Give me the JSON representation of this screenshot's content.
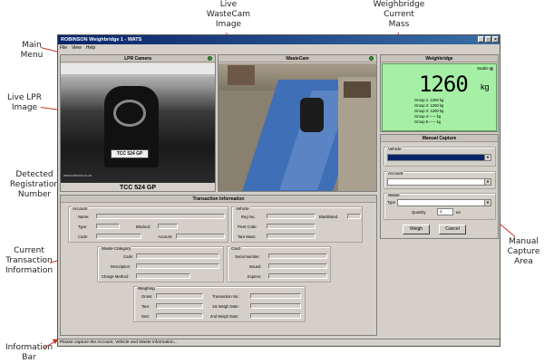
{
  "callouts": {
    "main_menu": "Main\nMenu",
    "live_wastecam": "Live\nWasteCam\nImage",
    "current_mass": "Weighbridge\nCurrent\nMass",
    "live_lpr": "Live LPR\nImage",
    "detected_reg": "Detected\nRegistration\nNumber",
    "current_tx": "Current\nTransaction\nInformation",
    "manual_capture": "Manual\nCapture\nArea",
    "info_bar": "Information\nBar"
  },
  "window": {
    "title": "ROBINSON Weighbridge 1 - WATS",
    "controls": [
      "_",
      "□",
      "×"
    ]
  },
  "menu": [
    "File",
    "View",
    "Help"
  ],
  "lpr": {
    "header": "LPR Camera",
    "plate": "TCC 524 GP",
    "overlay_text": "www.robinson.co.za"
  },
  "wastecam": {
    "header": "WasteCam"
  },
  "weighbridge": {
    "header": "Weighbridge",
    "stable": "Stable",
    "mass": "1260",
    "unit": "kg",
    "groups": [
      {
        "label": "Group 1:",
        "value": "1260 kg"
      },
      {
        "label": "Group 2:",
        "value": "1260 kg"
      },
      {
        "label": "Group 3:",
        "value": "1260 kg"
      },
      {
        "label": "Group 4------",
        "value": "kg"
      },
      {
        "label": "Group 5------",
        "value": "kg"
      }
    ]
  },
  "manual": {
    "header": "Manual Capture",
    "vehicle": "Vehicle",
    "account": "Account",
    "waste": "Waste",
    "type": "Type",
    "quantity": "Quantity",
    "quantity_value": "1",
    "quantity_unit": "ea",
    "weigh": "Weigh",
    "cancel": "Cancel"
  },
  "transaction": {
    "header": "Transaction Information",
    "account": {
      "title": "Account",
      "name": "Name:",
      "type": "Type:",
      "blocked": "Blocked:",
      "code": "Code:",
      "account": "Account:"
    },
    "vehicle": {
      "title": "Vehicle",
      "reg": "Reg No.:",
      "blacklisted": "Blacklisted:",
      "fleet": "Fleet Code:",
      "tare": "Tare Mass:"
    },
    "waste": {
      "title": "Waste Category",
      "code": "Code:",
      "description": "Description:",
      "charge": "Charge Method:"
    },
    "card": {
      "title": "Card",
      "serial": "Serial Number:",
      "issued": "Issued:",
      "expires": "Expires:"
    },
    "weighing": {
      "title": "Weighing",
      "gross": "Gross:",
      "tare": "Tare:",
      "nett": "Nett:",
      "tx_no": "Transaction No.:",
      "first": "1st Weigh Date:",
      "second": "2nd Weigh Date:"
    }
  },
  "status": "Please capture the Account, Vehicle and Waste information..."
}
